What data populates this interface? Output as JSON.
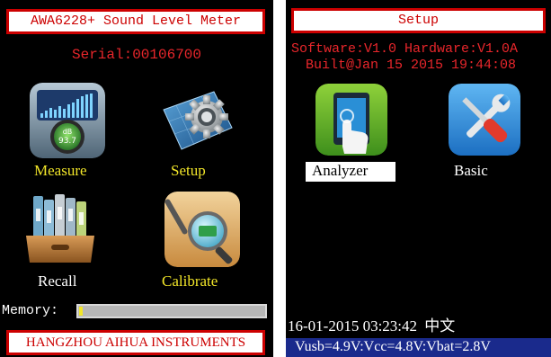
{
  "left_screen": {
    "title": "AWA6228+ Sound Level Meter",
    "serial": "Serial:00106700",
    "icons": [
      {
        "label": "Measure",
        "icon": "sound-meter-icon"
      },
      {
        "label": "Setup",
        "icon": "gear-icon"
      },
      {
        "label": "Recall",
        "icon": "file-folders-icon"
      },
      {
        "label": "Calibrate",
        "icon": "magnifier-icon"
      }
    ],
    "meter_badge": {
      "unit": "dB",
      "value": "93.7"
    },
    "memory_label": "Memory:",
    "memory_used_fraction": 0.02,
    "footer": "HANGZHOU AIHUA INSTRUMENTS"
  },
  "right_screen": {
    "title": "Setup",
    "software": "Software:V1.0 Hardware:V1.0A",
    "built": "Built@Jan 15 2015 19:44:08",
    "icons": [
      {
        "label": "Analyzer",
        "icon": "touch-screen-icon",
        "selected": true
      },
      {
        "label": "Basic",
        "icon": "tools-icon",
        "selected": false
      }
    ],
    "datetime": "16-01-2015 03:23:42",
    "language": "中文",
    "status": "Vusb=4.9V:Vcc=4.8V:Vbat=2.8V"
  },
  "colors": {
    "screen_bg": "#000000",
    "title_red": "#cc0000",
    "info_red": "#e8262b",
    "label_yellow": "#f2e629",
    "status_bar_blue": "#1a2a8c",
    "selected_bg": "#ffffff"
  }
}
